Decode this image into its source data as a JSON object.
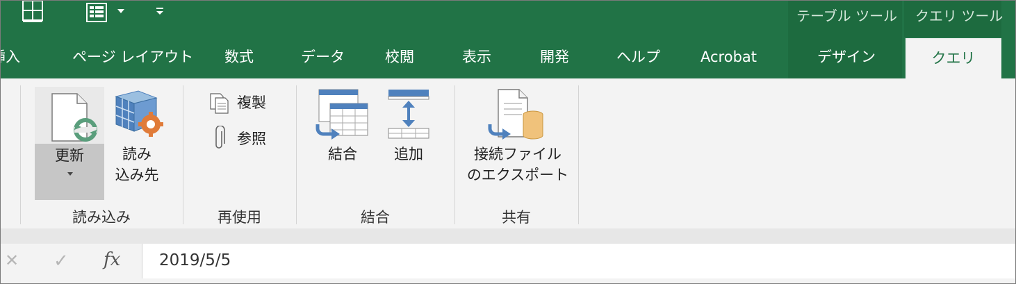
{
  "contextual_tabs": {
    "table_tools": "テーブル ツール",
    "query_tools": "クエリ ツール"
  },
  "tabs": [
    "挿入",
    "ページ レイアウト",
    "数式",
    "データ",
    "校閲",
    "表示",
    "開発",
    "ヘルプ",
    "Acrobat",
    "デザイン",
    "クエリ"
  ],
  "ribbon": {
    "load": {
      "group": "読み込み",
      "refresh": "更新",
      "load_to_line1": "読み",
      "load_to_line2": "込み先"
    },
    "reuse": {
      "group": "再使用",
      "duplicate": "複製",
      "reference": "参照"
    },
    "combine": {
      "group": "結合",
      "merge": "結合",
      "append": "追加"
    },
    "share": {
      "group": "共有",
      "export_line1": "接続ファイル",
      "export_line2": "のエクスポート"
    }
  },
  "formula_bar": {
    "cancel": "✕",
    "enter": "✓",
    "fx": "fx",
    "value": "2019/5/5"
  }
}
